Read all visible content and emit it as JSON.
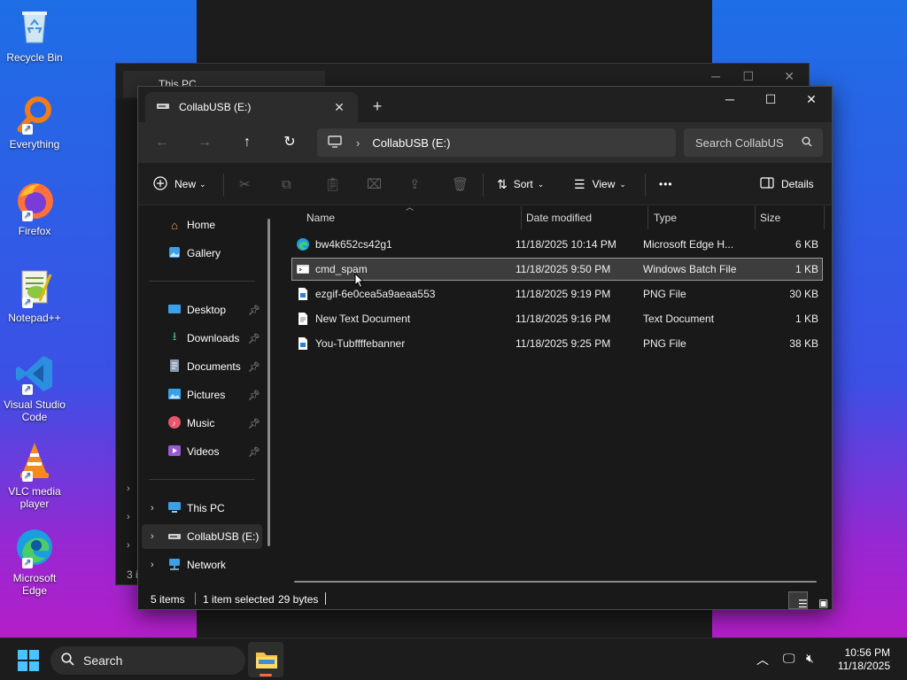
{
  "desktop": {
    "icons": [
      {
        "label": "Recycle Bin",
        "icon": "recycle-bin-icon"
      },
      {
        "label": "Everything",
        "icon": "everything-search-icon"
      },
      {
        "label": "Firefox",
        "icon": "firefox-icon"
      },
      {
        "label": "Notepad++",
        "icon": "notepadpp-icon"
      },
      {
        "label": "Visual Studio Code",
        "icon": "vscode-icon"
      },
      {
        "label": "VLC media player",
        "icon": "vlc-icon"
      },
      {
        "label": "Microsoft Edge",
        "icon": "edge-icon"
      }
    ]
  },
  "background_window": {
    "tab_title": "This PC",
    "status_partial": "3 i"
  },
  "window": {
    "tab_title": "CollabUSB (E:)",
    "new_tab": "+",
    "controls": {
      "minimize": "─",
      "maximize": "☐",
      "close": "✕"
    }
  },
  "address": {
    "path": "CollabUSB (E:)",
    "search_placeholder": "Search CollabUS"
  },
  "commands": {
    "new": "New",
    "sort": "Sort",
    "view": "View",
    "more": "•••",
    "details": "Details"
  },
  "nav": {
    "quick": [
      {
        "label": "Home",
        "icon": "home-icon"
      },
      {
        "label": "Gallery",
        "icon": "gallery-icon"
      }
    ],
    "pinned": [
      {
        "label": "Desktop",
        "icon": "desktop-folder-icon"
      },
      {
        "label": "Downloads",
        "icon": "downloads-icon"
      },
      {
        "label": "Documents",
        "icon": "documents-icon"
      },
      {
        "label": "Pictures",
        "icon": "pictures-icon"
      },
      {
        "label": "Music",
        "icon": "music-icon"
      },
      {
        "label": "Videos",
        "icon": "videos-icon"
      }
    ],
    "drives": [
      {
        "label": "This PC",
        "icon": "this-pc-icon"
      },
      {
        "label": "CollabUSB (E:)",
        "icon": "usb-drive-icon",
        "selected": true
      },
      {
        "label": "Network",
        "icon": "network-icon"
      }
    ]
  },
  "columns": {
    "name": "Name",
    "date": "Date modified",
    "type": "Type",
    "size": "Size"
  },
  "files": [
    {
      "name": "bw4k652cs42g1",
      "date": "11/18/2025 10:14 PM",
      "type": "Microsoft Edge H...",
      "size": "6 KB",
      "icon": "edge-html-file-icon"
    },
    {
      "name": "cmd_spam",
      "date": "11/18/2025 9:50 PM",
      "type": "Windows Batch File",
      "size": "1 KB",
      "icon": "batch-file-icon",
      "selected": true
    },
    {
      "name": "ezgif-6e0cea5a9aeaa553",
      "date": "11/18/2025 9:19 PM",
      "type": "PNG File",
      "size": "30 KB",
      "icon": "png-file-icon"
    },
    {
      "name": "New Text Document",
      "date": "11/18/2025 9:16 PM",
      "type": "Text Document",
      "size": "1 KB",
      "icon": "text-file-icon"
    },
    {
      "name": "You-Tubffffebanner",
      "date": "11/18/2025 9:25 PM",
      "type": "PNG File",
      "size": "38 KB",
      "icon": "png-file-icon"
    }
  ],
  "status": {
    "count": "5 items",
    "selection": "1 item selected",
    "bytes": "29 bytes"
  },
  "taskbar": {
    "search": "Search",
    "time": "10:56 PM",
    "date": "11/18/2025"
  },
  "colors": {
    "accent": "#0078d4",
    "folder": "#f4c542",
    "selection_bg": "#3d3d3d"
  }
}
